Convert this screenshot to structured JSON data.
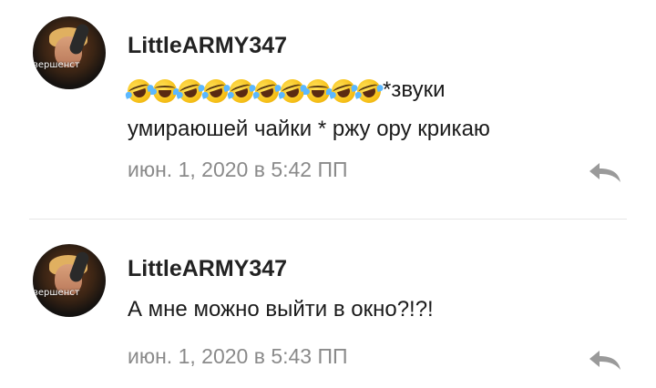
{
  "comments": [
    {
      "username": "LittleARMY347",
      "avatar_banner": "вершенст",
      "emoji_icons": [
        "rolling-on-floor-laughing-icon",
        "laughing-tears-icon",
        "rolling-on-floor-laughing-icon",
        "rolling-on-floor-laughing-icon",
        "rolling-on-floor-laughing-icon",
        "rolling-on-floor-laughing-icon",
        "rolling-on-floor-laughing-icon",
        "laughing-tears-icon",
        "rolling-on-floor-laughing-icon",
        "rolling-on-floor-laughing-icon"
      ],
      "text_after_emojis": "*звуки",
      "text_line2": "умираюшей чайки * ржу ору крикаю",
      "timestamp": "июн. 1, 2020 в 5:42 ПП",
      "reply_icon": "reply-arrow-icon"
    },
    {
      "username": "LittleARMY347",
      "avatar_banner": "вершенст",
      "text": "А мне можно выйти в окно?!?!",
      "timestamp": "июн. 1, 2020 в 5:43 ПП",
      "reply_icon": "reply-arrow-icon"
    }
  ],
  "colors": {
    "username": "#222222",
    "body_text": "#1b1b1b",
    "meta_text": "#8a8a8a",
    "reply_icon": "#9a9a9a",
    "divider": "#e6e6e6"
  }
}
